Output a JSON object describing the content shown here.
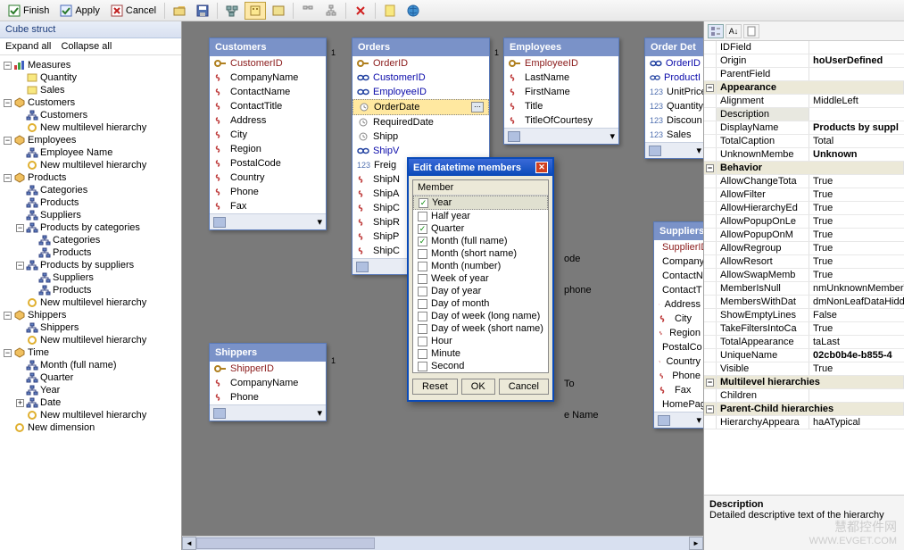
{
  "toolbar": {
    "finish": "Finish",
    "apply": "Apply",
    "cancel": "Cancel"
  },
  "left": {
    "title": "Cube struct",
    "expand": "Expand all",
    "collapse": "Collapse all",
    "tree": [
      {
        "lvl": 0,
        "exp": "-",
        "icon": "measures",
        "label": "Measures"
      },
      {
        "lvl": 1,
        "icon": "measure",
        "label": "Quantity"
      },
      {
        "lvl": 1,
        "icon": "measure",
        "label": "Sales"
      },
      {
        "lvl": 0,
        "exp": "-",
        "icon": "dim",
        "label": "Customers"
      },
      {
        "lvl": 1,
        "icon": "hier",
        "label": "Customers"
      },
      {
        "lvl": 1,
        "icon": "new",
        "label": "New multilevel hierarchy"
      },
      {
        "lvl": 0,
        "exp": "-",
        "icon": "dim",
        "label": "Employees"
      },
      {
        "lvl": 1,
        "icon": "hier",
        "label": "Employee Name"
      },
      {
        "lvl": 1,
        "icon": "new",
        "label": "New multilevel hierarchy"
      },
      {
        "lvl": 0,
        "exp": "-",
        "icon": "dim",
        "label": "Products"
      },
      {
        "lvl": 1,
        "icon": "hier",
        "label": "Categories"
      },
      {
        "lvl": 1,
        "icon": "hier",
        "label": "Products"
      },
      {
        "lvl": 1,
        "icon": "hier",
        "label": "Suppliers"
      },
      {
        "lvl": 1,
        "exp": "-",
        "icon": "hier",
        "label": "Products by categories"
      },
      {
        "lvl": 2,
        "icon": "hier",
        "label": "Categories"
      },
      {
        "lvl": 2,
        "icon": "hier",
        "label": "Products"
      },
      {
        "lvl": 1,
        "exp": "-",
        "icon": "hier",
        "label": "Products by suppliers"
      },
      {
        "lvl": 2,
        "icon": "hier",
        "label": "Suppliers"
      },
      {
        "lvl": 2,
        "icon": "hier",
        "label": "Products"
      },
      {
        "lvl": 1,
        "icon": "new",
        "label": "New multilevel hierarchy"
      },
      {
        "lvl": 0,
        "exp": "-",
        "icon": "dim",
        "label": "Shippers"
      },
      {
        "lvl": 1,
        "icon": "hier",
        "label": "Shippers"
      },
      {
        "lvl": 1,
        "icon": "new",
        "label": "New multilevel hierarchy"
      },
      {
        "lvl": 0,
        "exp": "-",
        "icon": "dim",
        "label": "Time"
      },
      {
        "lvl": 1,
        "icon": "hier",
        "label": "Month (full name)"
      },
      {
        "lvl": 1,
        "icon": "hier",
        "label": "Quarter"
      },
      {
        "lvl": 1,
        "icon": "hier",
        "label": "Year"
      },
      {
        "lvl": 1,
        "exp": "+",
        "icon": "hier",
        "label": "Date"
      },
      {
        "lvl": 1,
        "icon": "new",
        "label": "New multilevel hierarchy"
      },
      {
        "lvl": 0,
        "icon": "new",
        "label": "New dimension"
      }
    ]
  },
  "entities": {
    "customers": {
      "title": "Customers",
      "fields": [
        {
          "n": "CustomerID",
          "t": "pk"
        },
        {
          "n": "CompanyName",
          "t": "s"
        },
        {
          "n": "ContactName",
          "t": "s"
        },
        {
          "n": "ContactTitle",
          "t": "s"
        },
        {
          "n": "Address",
          "t": "s"
        },
        {
          "n": "City",
          "t": "s"
        },
        {
          "n": "Region",
          "t": "s"
        },
        {
          "n": "PostalCode",
          "t": "s"
        },
        {
          "n": "Country",
          "t": "s"
        },
        {
          "n": "Phone",
          "t": "s"
        },
        {
          "n": "Fax",
          "t": "s"
        }
      ]
    },
    "orders": {
      "title": "Orders",
      "fields": [
        {
          "n": "OrderID",
          "t": "pk"
        },
        {
          "n": "CustomerID",
          "t": "fk"
        },
        {
          "n": "EmployeeID",
          "t": "fk"
        },
        {
          "n": "OrderDate",
          "t": "d",
          "sel": true
        },
        {
          "n": "RequiredDate",
          "t": "d"
        },
        {
          "n": "Shipp",
          "t": "d"
        },
        {
          "n": "ShipV",
          "t": "fk"
        },
        {
          "n": "Freig",
          "t": "n"
        },
        {
          "n": "ShipN",
          "t": "s"
        },
        {
          "n": "ShipA",
          "t": "s"
        },
        {
          "n": "ShipC",
          "t": "s"
        },
        {
          "n": "ShipR",
          "t": "s"
        },
        {
          "n": "ShipP",
          "t": "s"
        },
        {
          "n": "ShipC",
          "t": "s"
        }
      ]
    },
    "employees": {
      "title": "Employees",
      "fields": [
        {
          "n": "EmployeeID",
          "t": "pk"
        },
        {
          "n": "LastName",
          "t": "s"
        },
        {
          "n": "FirstName",
          "t": "s"
        },
        {
          "n": "Title",
          "t": "s"
        },
        {
          "n": "TitleOfCourtesy",
          "t": "s"
        }
      ]
    },
    "shippers": {
      "title": "Shippers",
      "fields": [
        {
          "n": "ShipperID",
          "t": "pk"
        },
        {
          "n": "CompanyName",
          "t": "s"
        },
        {
          "n": "Phone",
          "t": "s"
        }
      ]
    },
    "orderdetails": {
      "title": "Order Det",
      "fields": [
        {
          "n": "OrderID",
          "t": "fk"
        },
        {
          "n": "ProductI",
          "t": "fk"
        },
        {
          "n": "UnitPrice",
          "t": "n"
        },
        {
          "n": "Quantity",
          "t": "n"
        },
        {
          "n": "Discoun",
          "t": "n"
        },
        {
          "n": "Sales",
          "t": "n"
        }
      ]
    },
    "suppliers": {
      "title": "Suppliers",
      "fields": [
        {
          "n": "SupplierID",
          "t": "pk"
        },
        {
          "n": "Company",
          "t": "s"
        },
        {
          "n": "ContactN",
          "t": "s"
        },
        {
          "n": "ContactT",
          "t": "s"
        },
        {
          "n": "Address",
          "t": "s"
        },
        {
          "n": "City",
          "t": "s"
        },
        {
          "n": "Region",
          "t": "s"
        },
        {
          "n": "PostalCo",
          "t": "s"
        },
        {
          "n": "Country",
          "t": "s"
        },
        {
          "n": "Phone",
          "t": "s"
        },
        {
          "n": "Fax",
          "t": "s"
        },
        {
          "n": "HomePag",
          "t": "s"
        }
      ]
    },
    "hidden": {
      "fields": [
        {
          "n": "ode"
        },
        {
          "n": "phone"
        },
        {
          "n": "To"
        },
        {
          "n": "e Name"
        }
      ]
    }
  },
  "dialog": {
    "title": "Edit datetime members",
    "header": "Member",
    "items": [
      {
        "label": "Year",
        "c": true,
        "sel": true
      },
      {
        "label": "Half year",
        "c": false
      },
      {
        "label": "Quarter",
        "c": true
      },
      {
        "label": "Month (full name)",
        "c": true
      },
      {
        "label": "Month (short name)",
        "c": false
      },
      {
        "label": "Month (number)",
        "c": false
      },
      {
        "label": "Week of year",
        "c": false
      },
      {
        "label": "Day of year",
        "c": false
      },
      {
        "label": "Day of month",
        "c": false
      },
      {
        "label": "Day of week (long name)",
        "c": false
      },
      {
        "label": "Day of week (short name)",
        "c": false
      },
      {
        "label": "Hour",
        "c": false
      },
      {
        "label": "Minute",
        "c": false
      },
      {
        "label": "Second",
        "c": false
      }
    ],
    "reset": "Reset",
    "ok": "OK",
    "cancel": "Cancel"
  },
  "props": {
    "rows": [
      {
        "name": "IDField",
        "val": ""
      },
      {
        "name": "Origin",
        "val": "hoUserDefined",
        "b": true
      },
      {
        "name": "ParentField",
        "val": ""
      },
      {
        "cat": "Appearance"
      },
      {
        "name": "Alignment",
        "val": "MiddleLeft"
      },
      {
        "name": "Description",
        "val": "",
        "hl": true
      },
      {
        "name": "DisplayName",
        "val": "Products by suppl",
        "b": true
      },
      {
        "name": "TotalCaption",
        "val": "Total"
      },
      {
        "name": "UnknownMembe",
        "val": "Unknown",
        "b": true
      },
      {
        "cat": "Behavior"
      },
      {
        "name": "AllowChangeTota",
        "val": "True"
      },
      {
        "name": "AllowFilter",
        "val": "True"
      },
      {
        "name": "AllowHierarchyEd",
        "val": "True"
      },
      {
        "name": "AllowPopupOnLe",
        "val": "True"
      },
      {
        "name": "AllowPopupOnM",
        "val": "True"
      },
      {
        "name": "AllowRegroup",
        "val": "True"
      },
      {
        "name": "AllowResort",
        "val": "True"
      },
      {
        "name": "AllowSwapMemb",
        "val": "True"
      },
      {
        "name": "MemberIsNull",
        "val": "nmUnknownMemberV"
      },
      {
        "name": "MembersWithDat",
        "val": "dmNonLeafDataHidd"
      },
      {
        "name": "ShowEmptyLines",
        "val": "False"
      },
      {
        "name": "TakeFiltersIntoCa",
        "val": "True"
      },
      {
        "name": "TotalAppearance",
        "val": "taLast"
      },
      {
        "name": "UniqueName",
        "val": "02cb0b4e-b855-4",
        "b": true
      },
      {
        "name": "Visible",
        "val": "True"
      },
      {
        "cat": "Multilevel hierarchies"
      },
      {
        "name": "Children",
        "val": ""
      },
      {
        "cat": "Parent-Child hierarchies"
      },
      {
        "name": "HierarchyAppeara",
        "val": "haATypical"
      }
    ],
    "desc_title": "Description",
    "desc_text": "Detailed descriptive text of the hierarchy"
  },
  "watermark": {
    "l1": "慧都控件网",
    "l2": "WWW.EVGET.COM"
  }
}
